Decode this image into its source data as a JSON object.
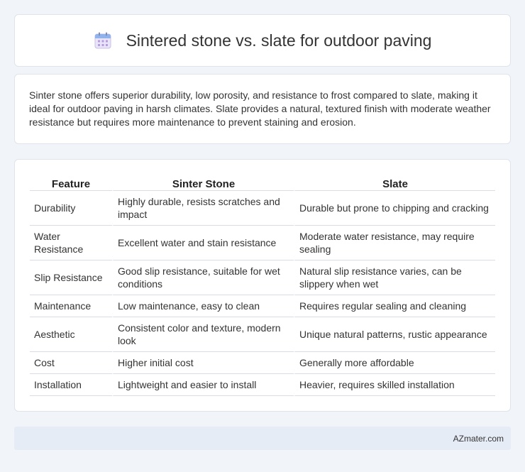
{
  "header": {
    "title": "Sintered stone vs. slate for outdoor paving",
    "icon": "calendar-icon"
  },
  "summary": "Sinter stone offers superior durability, low porosity, and resistance to frost compared to slate, making it ideal for outdoor paving in harsh climates. Slate provides a natural, textured finish with moderate weather resistance but requires more maintenance to prevent staining and erosion.",
  "table": {
    "headers": [
      "Feature",
      "Sinter Stone",
      "Slate"
    ],
    "rows": [
      [
        "Durability",
        "Highly durable, resists scratches and impact",
        "Durable but prone to chipping and cracking"
      ],
      [
        "Water Resistance",
        "Excellent water and stain resistance",
        "Moderate water resistance, may require sealing"
      ],
      [
        "Slip Resistance",
        "Good slip resistance, suitable for wet conditions",
        "Natural slip resistance varies, can be slippery when wet"
      ],
      [
        "Maintenance",
        "Low maintenance, easy to clean",
        "Requires regular sealing and cleaning"
      ],
      [
        "Aesthetic",
        "Consistent color and texture, modern look",
        "Unique natural patterns, rustic appearance"
      ],
      [
        "Cost",
        "Higher initial cost",
        "Generally more affordable"
      ],
      [
        "Installation",
        "Lightweight and easier to install",
        "Heavier, requires skilled installation"
      ]
    ]
  },
  "footer": {
    "text": "AZmater.com"
  },
  "colors": {
    "background": "#f1f4f9",
    "card": "#ffffff",
    "footer": "#e6ecf6"
  }
}
